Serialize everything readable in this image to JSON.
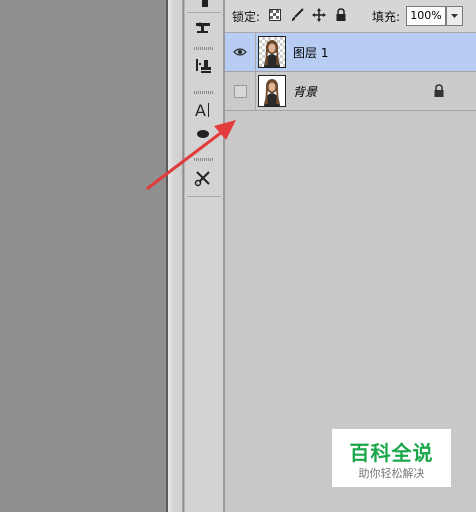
{
  "layers_panel": {
    "lock_label": "锁定:",
    "fill_label": "填充:",
    "fill_value": "100%",
    "layers": [
      {
        "name": "图层 1",
        "visible": true,
        "selected": true,
        "locked": false
      },
      {
        "name": "背景",
        "visible": false,
        "selected": false,
        "locked": true
      }
    ]
  },
  "toolbar": {
    "tools": [
      "brush-icon",
      "clone-stamp-icon",
      "stamp-icon",
      "type-tool-icon",
      "shape-icon",
      "scissors-icon"
    ]
  },
  "annotation": {
    "arrow_color": "#e23b3b"
  },
  "watermark": {
    "title": "百科全说",
    "subtitle": "助你轻松解决",
    "title_color": "#1aa64a"
  },
  "colors": {
    "selected_row": "#b8cdf2",
    "panel_bg": "#c8c8c8",
    "canvas_bg": "#8f8f8f"
  }
}
